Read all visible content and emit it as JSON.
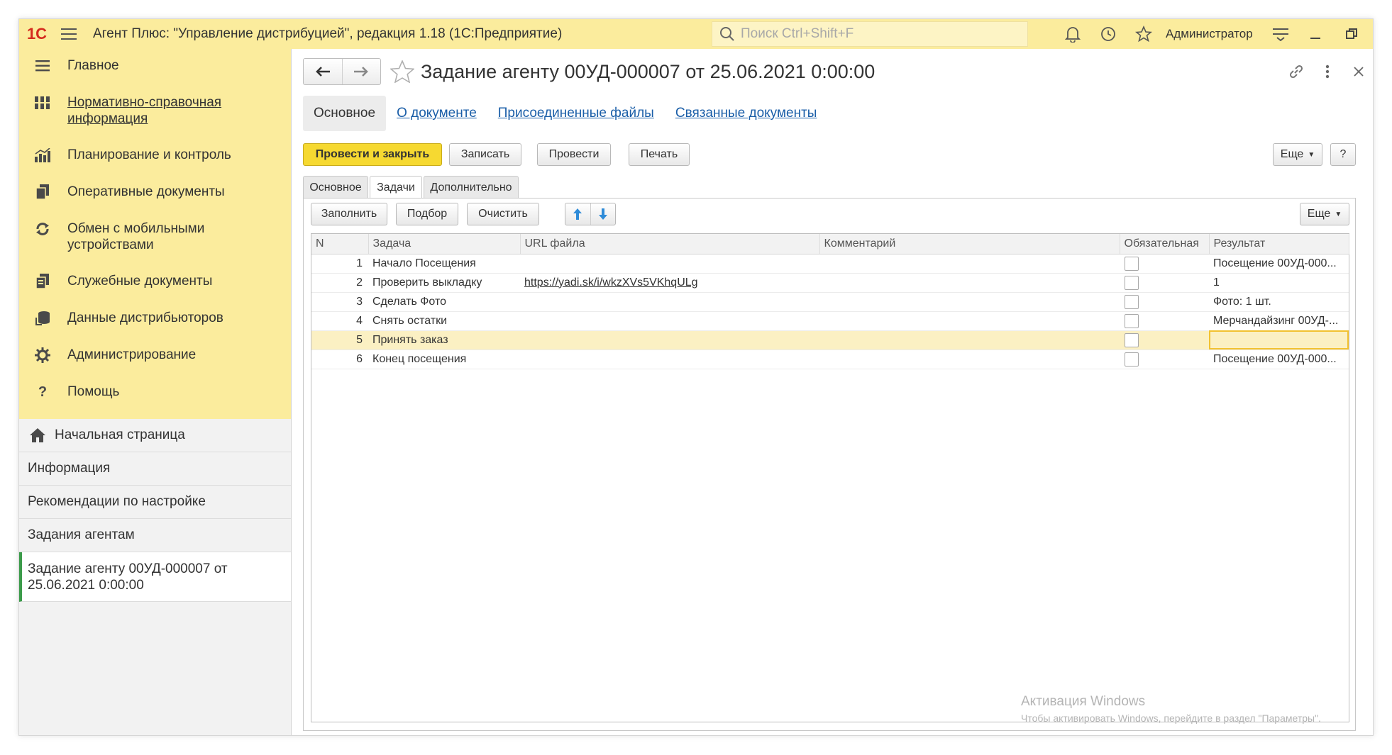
{
  "app": {
    "logo": "1С",
    "title": "Агент Плюс: \"Управление дистрибуцией\", редакция 1.18  (1С:Предприятие)",
    "search_placeholder": "Поиск Ctrl+Shift+F",
    "user": "Администратор"
  },
  "sidebar": {
    "sections": [
      {
        "label": "Главное",
        "icon": "menu-lines-icon"
      },
      {
        "label": "Нормативно-справочная информация",
        "icon": "grid-icon"
      },
      {
        "label": "Планирование и контроль",
        "icon": "bar-chart-icon"
      },
      {
        "label": "Оперативные документы",
        "icon": "documents-icon"
      },
      {
        "label": "Обмен с мобильными устройствами",
        "icon": "sync-icon"
      },
      {
        "label": "Служебные документы",
        "icon": "service-docs-icon"
      },
      {
        "label": "Данные дистрибьюторов",
        "icon": "database-icon"
      },
      {
        "label": "Администрирование",
        "icon": "gear-icon"
      },
      {
        "label": "Помощь",
        "icon": "question-icon"
      }
    ],
    "open_windows": [
      {
        "label": "Начальная страница"
      },
      {
        "label": "Информация"
      },
      {
        "label": "Рекомендации по настройке"
      },
      {
        "label": "Задания агентам"
      },
      {
        "label": "Задание агенту 00УД-000007 от 25.06.2021 0:00:00"
      }
    ]
  },
  "document": {
    "title": "Задание агенту 00УД-000007 от 25.06.2021 0:00:00",
    "tabs": [
      "Основное",
      "О документе",
      "Присоединенные файлы",
      "Связанные документы"
    ],
    "toolbar": {
      "post_close": "Провести и закрыть",
      "save": "Записать",
      "post": "Провести",
      "print": "Печать",
      "more": "Еще",
      "help": "?"
    },
    "inner_tabs": [
      "Основное",
      "Задачи",
      "Дополнительно"
    ],
    "tasks_toolbar": {
      "fill": "Заполнить",
      "pick": "Подбор",
      "clear": "Очистить",
      "more": "Еще"
    },
    "grid": {
      "columns": [
        "N",
        "Задача",
        "URL файла",
        "Комментарий",
        "Обязательная",
        "Результат"
      ],
      "rows": [
        {
          "n": "1",
          "task": "Начало Посещения",
          "url": "",
          "comment": "",
          "result": "Посещение 00УД-000..."
        },
        {
          "n": "2",
          "task": "Проверить выкладку",
          "url": "https://yadi.sk/i/wkzXVs5VKhqULg",
          "comment": "",
          "result": "1"
        },
        {
          "n": "3",
          "task": "Сделать Фото",
          "url": "",
          "comment": "",
          "result": "Фото: 1 шт."
        },
        {
          "n": "4",
          "task": "Снять остатки",
          "url": "",
          "comment": "",
          "result": "Мерчандайзинг 00УД-..."
        },
        {
          "n": "5",
          "task": "Принять заказ",
          "url": "",
          "comment": "",
          "result": ""
        },
        {
          "n": "6",
          "task": "Конец посещения",
          "url": "",
          "comment": "",
          "result": "Посещение 00УД-000..."
        }
      ]
    }
  },
  "watermark": {
    "line1": "Активация Windows",
    "line2": "Чтобы активировать Windows, перейдите в раздел \"Параметры\"."
  }
}
